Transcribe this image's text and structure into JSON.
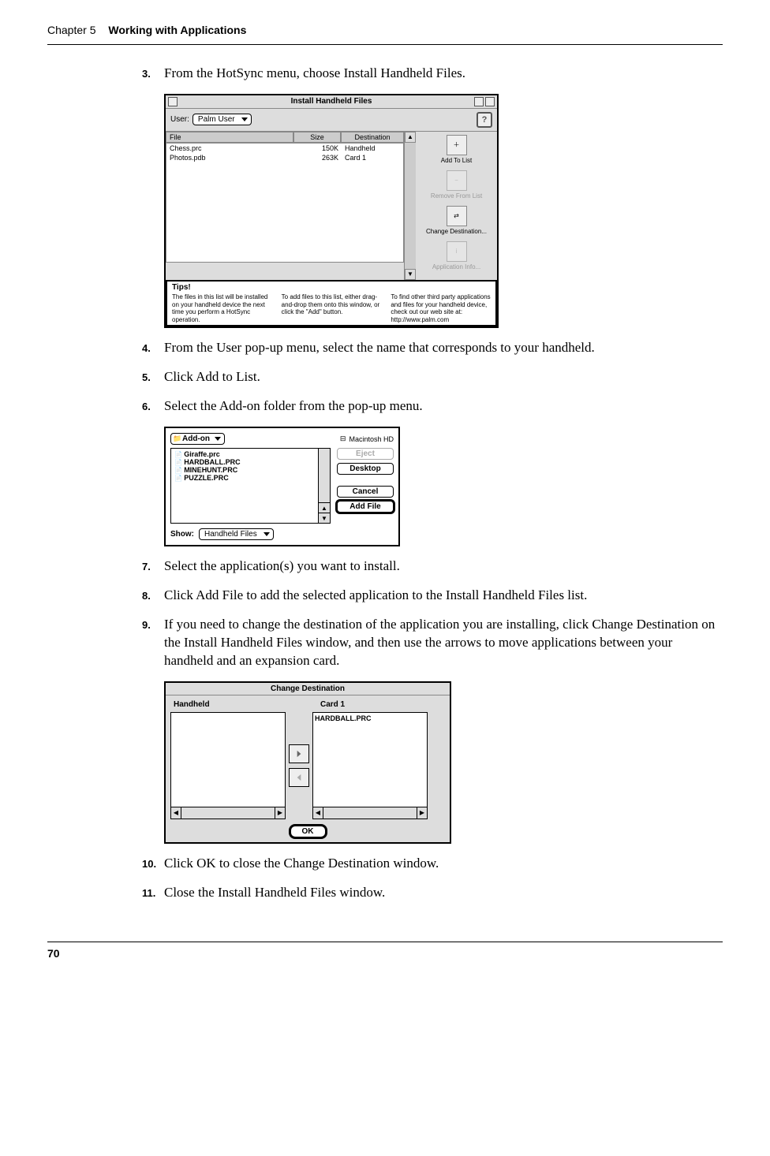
{
  "header": {
    "chapter_num": "Chapter 5",
    "chapter_title": "Working with Applications"
  },
  "steps": {
    "s3": {
      "num": "3.",
      "text": "From the HotSync menu, choose Install Handheld Files."
    },
    "s4": {
      "num": "4.",
      "text": "From the User pop-up menu, select the name that corresponds to your handheld."
    },
    "s5": {
      "num": "5.",
      "text": "Click Add to List."
    },
    "s6": {
      "num": "6.",
      "text": "Select the Add-on folder from the pop-up menu."
    },
    "s7": {
      "num": "7.",
      "text": "Select the application(s) you want to install."
    },
    "s8": {
      "num": "8.",
      "text": "Click Add File to add the selected application to the Install Handheld Files list."
    },
    "s9": {
      "num": "9.",
      "text": "If you need to change the destination of the application you are installing, click Change Destination on the Install Handheld Files window, and then use the arrows to move applications between your handheld and an expansion card."
    },
    "s10": {
      "num": "10.",
      "text": "Click OK to close the Change Destination window."
    },
    "s11": {
      "num": "11.",
      "text": "Close the Install Handheld Files window."
    }
  },
  "fig1": {
    "title": "Install Handheld Files",
    "user_label": "User:",
    "user_value": "Palm User",
    "help": "?",
    "col_file": "File",
    "col_size": "Size",
    "col_dest": "Destination",
    "rows": [
      {
        "file": "Chess.prc",
        "size": "150K",
        "dest": "Handheld"
      },
      {
        "file": "Photos.pdb",
        "size": "263K",
        "dest": "Card 1"
      }
    ],
    "side": {
      "add": "Add To List",
      "remove": "Remove From List",
      "change": "Change Destination...",
      "info": "Application Info..."
    },
    "tips_title": "Tips!",
    "tips1": "The files in this list will be installed on your handheld device the next time you perform a HotSync operation.",
    "tips2": "To add files to this list, either drag-and-drop them onto this window, or click the \"Add\" button.",
    "tips3": "To find other third party applications and files for your handheld device, check out our web site at: http://www.palm.com"
  },
  "fig2": {
    "folder": "Add-on",
    "drive": "Macintosh HD",
    "items": [
      "Giraffe.prc",
      "HARDBALL.PRC",
      "MINEHUNT.PRC",
      "PUZZLE.PRC"
    ],
    "btn_eject": "Eject",
    "btn_desktop": "Desktop",
    "btn_cancel": "Cancel",
    "btn_add": "Add File",
    "show_label": "Show:",
    "show_value": "Handheld Files"
  },
  "fig3": {
    "title": "Change Destination",
    "col_handheld": "Handheld",
    "col_card": "Card 1",
    "item": "HARDBALL.PRC",
    "ok": "OK"
  },
  "page_number": "70"
}
